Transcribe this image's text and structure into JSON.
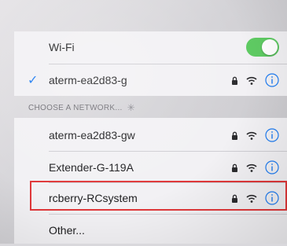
{
  "wifi": {
    "title": "Wi-Fi",
    "toggle_on": true,
    "connected_network": "aterm-ea2d83-g"
  },
  "choose_section": {
    "header": "CHOOSE A NETWORK..."
  },
  "networks": [
    {
      "name": "aterm-ea2d83-gw",
      "locked": true,
      "has_wifi_icon": true,
      "has_info": true
    },
    {
      "name": "Extender-G-119A",
      "locked": true,
      "has_wifi_icon": true,
      "has_info": true
    },
    {
      "name": "rcberry-RCsystem",
      "locked": true,
      "has_wifi_icon": true,
      "has_info": true
    }
  ],
  "other": {
    "label": "Other..."
  },
  "colors": {
    "accent": "#1e7cf2",
    "toggle": "#5fcb63",
    "highlight": "#e0383a"
  },
  "icons": {
    "lock": "lock-icon",
    "wifi": "wifi-icon",
    "info": "info-icon",
    "check": "checkmark-icon",
    "spinner": "spinner-icon"
  }
}
